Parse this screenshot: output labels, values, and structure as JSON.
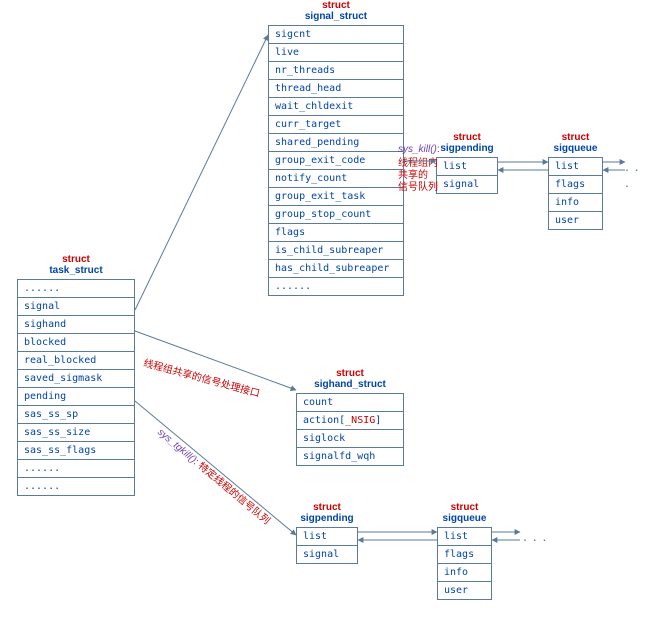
{
  "task_struct": {
    "keyword": "struct",
    "name": "task_struct",
    "fields": [
      "......",
      "signal",
      "sighand",
      "blocked",
      "real_blocked",
      "saved_sigmask",
      "pending",
      "sas_ss_sp",
      "sas_ss_size",
      "sas_ss_flags",
      "......",
      "......"
    ]
  },
  "signal_struct": {
    "keyword": "struct",
    "name": "signal_struct",
    "fields": [
      "sigcnt",
      "live",
      "nr_threads",
      "thread_head",
      "wait_chldexit",
      "curr_target",
      "shared_pending",
      "group_exit_code",
      "notify_count",
      "group_exit_task",
      "group_stop_count",
      "flags",
      "is_child_subreaper",
      "has_child_subreaper",
      "......"
    ]
  },
  "sigpending_top": {
    "keyword": "struct",
    "name": "sigpending",
    "fields": [
      "list",
      "signal"
    ]
  },
  "sigqueue_top": {
    "keyword": "struct",
    "name": "sigqueue",
    "fields": [
      "list",
      "flags",
      "info",
      "user"
    ]
  },
  "sighand_struct": {
    "keyword": "struct",
    "name": "sighand_struct",
    "fields_plain": [
      "count",
      "siglock",
      "signalfd_wqh"
    ],
    "action_prefix": "action[",
    "action_nsig": "_NSIG",
    "action_suffix": "]"
  },
  "sigpending_bot": {
    "keyword": "struct",
    "name": "sigpending",
    "fields": [
      "list",
      "signal"
    ]
  },
  "sigqueue_bot": {
    "keyword": "struct",
    "name": "sigqueue",
    "fields": [
      "list",
      "flags",
      "info",
      "user"
    ]
  },
  "annotations": {
    "sys_kill_fn": "sys_kill()",
    "sys_kill_colon": ":",
    "sys_kill_cn1": "线程组内共享的",
    "sys_kill_cn2": "信号队列",
    "sighand_label": "线程组共享的信号处理接口",
    "sys_tgkill_fn": "sys_tgkill()",
    "sys_tgkill_colon": ":",
    "sys_tgkill_cn": "特定线程的信号队列"
  },
  "ellipsis": ". . ."
}
